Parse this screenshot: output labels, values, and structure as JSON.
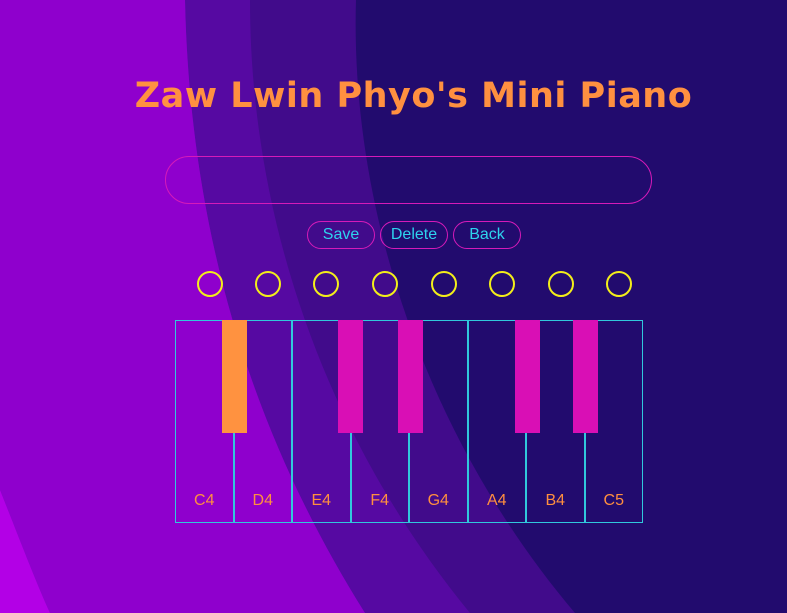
{
  "title": "Zaw Lwin Phyo's Mini Piano",
  "record_input": {
    "value": "",
    "placeholder": ""
  },
  "buttons": {
    "save": "Save",
    "delete": "Delete",
    "back": "Back"
  },
  "circles": [
    {
      "name": "record-slot-1"
    },
    {
      "name": "record-slot-2"
    },
    {
      "name": "record-slot-3"
    },
    {
      "name": "record-slot-4"
    },
    {
      "name": "record-slot-5"
    },
    {
      "name": "record-slot-6"
    },
    {
      "name": "record-slot-7"
    },
    {
      "name": "record-slot-8"
    }
  ],
  "white_keys": [
    "C4",
    "D4",
    "E4",
    "F4",
    "G4",
    "A4",
    "B4",
    "C5"
  ],
  "black_keys": [
    {
      "name": "C#4",
      "active": true
    },
    {
      "name": "D#4",
      "active": false
    },
    {
      "name": "F#4",
      "active": false
    },
    {
      "name": "G#4",
      "active": false
    },
    {
      "name": "A#4",
      "active": false
    }
  ],
  "colors": {
    "title": "#ff9040",
    "button_text": "#2ed3ee",
    "button_border": "#d61ab9",
    "circle": "#f3ee1a",
    "black_key": "#d90fb5",
    "black_key_active": "#ff9240",
    "white_key_border": "#31c8dc",
    "note_label": "#ff8f3f"
  }
}
